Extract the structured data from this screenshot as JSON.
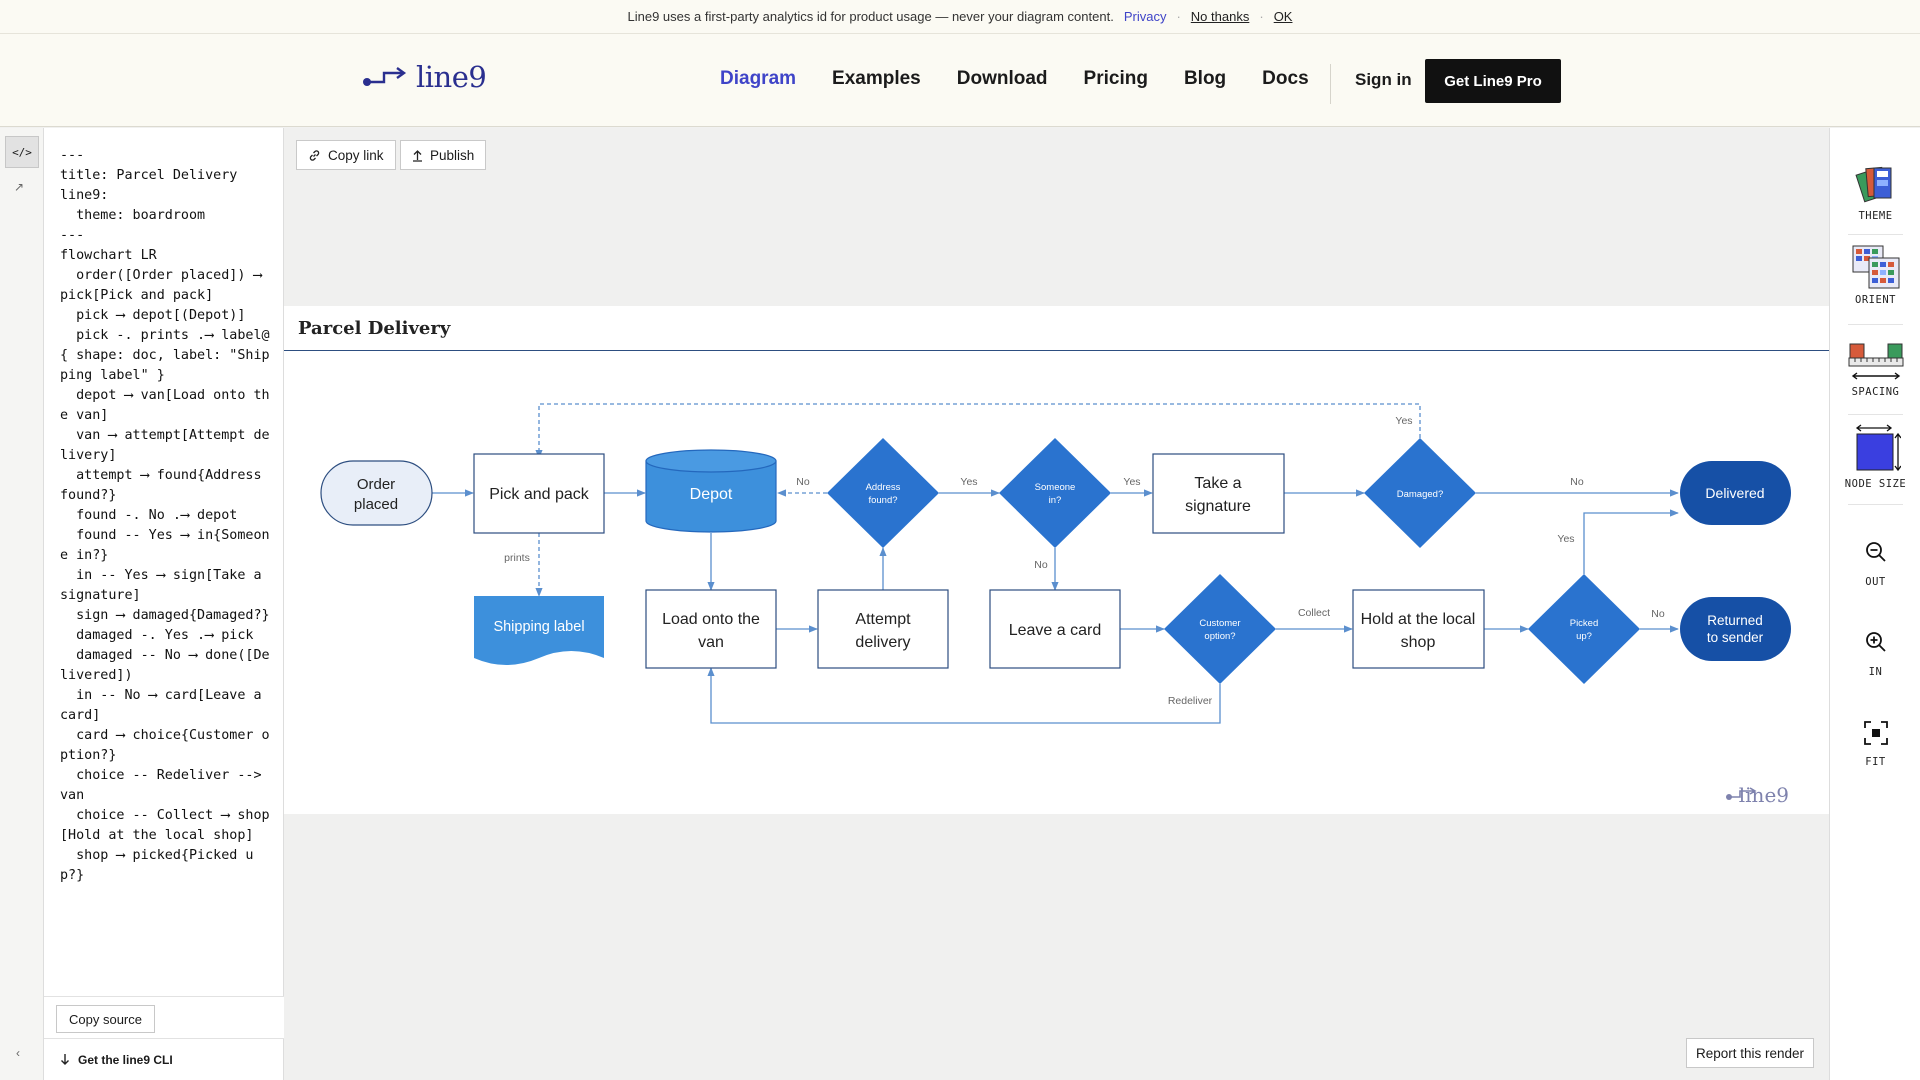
{
  "banner": {
    "message": "Line9 uses a first-party analytics id for product usage — never your diagram content.",
    "privacy": "Privacy",
    "dot": "·",
    "no_thanks": "No thanks",
    "ok": "OK"
  },
  "nav": {
    "logo": "line9",
    "links": [
      "Diagram",
      "Examples",
      "Download",
      "Pricing",
      "Blog",
      "Docs"
    ],
    "active": "Diagram",
    "signin": "Sign in",
    "cta": "Get Line9 Pro"
  },
  "editor": {
    "source": "---\ntitle: Parcel Delivery\nline9:\n  theme: boardroom\n---\nflowchart LR\n  order([Order placed]) ⟶ pick[Pick and pack]\n  pick ⟶ depot[(Depot)]\n  pick -. prints .⟶ label@{ shape: doc, label: \"Shipping label\" }\n  depot ⟶ van[Load onto the van]\n  van ⟶ attempt[Attempt delivery]\n  attempt ⟶ found{Address found?}\n  found -. No .⟶ depot\n  found -- Yes ⟶ in{Someone in?}\n  in -- Yes ⟶ sign[Take a signature]\n  sign ⟶ damaged{Damaged?}\n  damaged -. Yes .⟶ pick\n  damaged -- No ⟶ done([Delivered])\n  in -- No ⟶ card[Leave a card]\n  card ⟶ choice{Customer option?}\n  choice -- Redeliver --> van\n  choice -- Collect ⟶ shop[Hold at the local shop]\n  shop ⟶ picked{Picked up?}",
    "copy_source": "Copy source",
    "cli": "Get the line9 CLI",
    "rail_code": "</>",
    "rail_arrow": "↗",
    "rail_collapse": "‹"
  },
  "toolbar": {
    "copy_link": "Copy link",
    "publish": "Publish",
    "report": "Report this render"
  },
  "diagram": {
    "title": "Parcel Delivery",
    "watermark": "line9",
    "nodes": {
      "order": [
        "Order",
        "placed"
      ],
      "pick": [
        "Pick and pack"
      ],
      "depot": [
        "Depot"
      ],
      "label": [
        "Shipping label"
      ],
      "van": [
        "Load onto the",
        "van"
      ],
      "attempt": [
        "Attempt",
        "delivery"
      ],
      "found": [
        "Address",
        "found?"
      ],
      "in": [
        "Someone",
        "in?"
      ],
      "sign": [
        "Take a",
        "signature"
      ],
      "card": [
        "Leave a card"
      ],
      "choice": [
        "Customer",
        "option?"
      ],
      "damaged": [
        "Damaged?"
      ],
      "shop": [
        "Hold at the local",
        "shop"
      ],
      "picked": [
        "Picked",
        "up?"
      ],
      "done": [
        "Delivered"
      ],
      "returned": [
        "Returned",
        "to sender"
      ]
    },
    "edge_labels": {
      "prints": "prints",
      "found_no": "No",
      "found_yes": "Yes",
      "in_yes": "Yes",
      "in_no": "No",
      "damaged_yes": "Yes",
      "damaged_no": "No",
      "collect": "Collect",
      "redeliver": "Redeliver",
      "picked_yes": "Yes",
      "picked_no": "No"
    },
    "colors": {
      "primary": "#2a73cf",
      "depot": "#3d90dc",
      "terminal": "#1650a6",
      "edge": "#5b8fce",
      "order_fill": "#e8eef8"
    }
  },
  "rightrail": {
    "theme": "THEME",
    "orient": "ORIENT",
    "spacing": "SPACING",
    "node_size": "NODE SIZE",
    "out": "OUT",
    "in": "IN",
    "fit": "FIT"
  }
}
